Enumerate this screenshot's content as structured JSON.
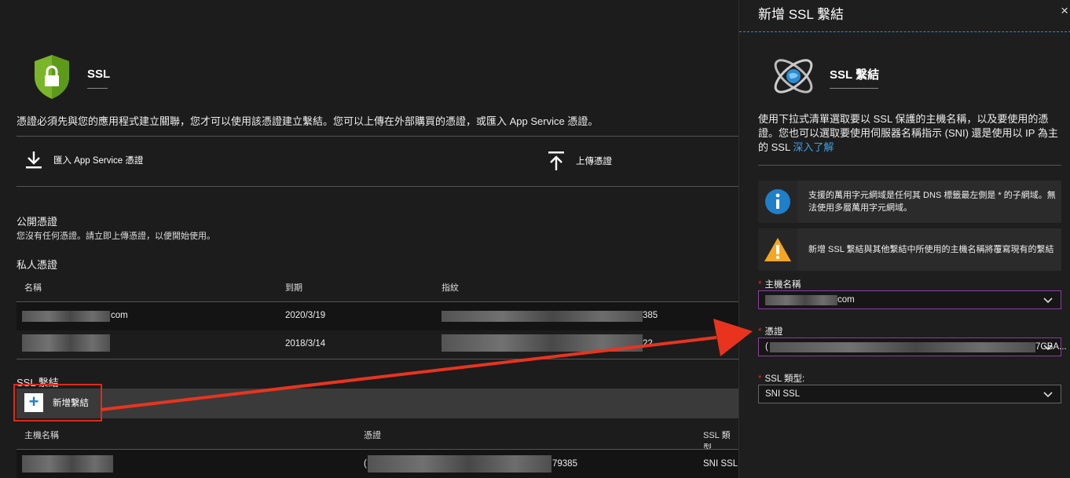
{
  "main": {
    "title": "SSL",
    "description": "憑證必須先與您的應用程式建立關聯，您才可以使用該憑證建立繫結。您可以上傳在外部購買的憑證，或匯入 App Service 憑證。",
    "commands": {
      "import_label": "匯入 App Service 憑證",
      "upload_label": "上傳憑證"
    },
    "public_certs": {
      "title": "公開憑證",
      "empty_text": "您沒有任何憑證。請立即上傳憑證，以便開始使用。"
    },
    "private_certs": {
      "title": "私人憑證",
      "columns": [
        "名稱",
        "到期",
        "指紋"
      ],
      "rows": [
        {
          "name_suffix": "com",
          "expiry": "2020/3/19",
          "thumb_suffix": "385"
        },
        {
          "name_suffix": "",
          "expiry": "2018/3/14",
          "thumb_suffix": "22"
        }
      ]
    },
    "bindings": {
      "title": "SSL 繫結",
      "add_label": "新增繫結",
      "columns": [
        "主機名稱",
        "憑證",
        "SSL 類型"
      ],
      "rows": [
        {
          "cert_prefix": "(",
          "cert_suffix": "79385",
          "ssl_type": "SNI SSL"
        }
      ]
    }
  },
  "panel": {
    "title": "新增 SSL 繫結",
    "close_glyph": "×",
    "subtitle": "SSL 繫結",
    "description": "使用下拉式清單選取要以 SSL 保護的主機名稱，以及要使用的憑證。您也可以選取要使用伺服器名稱指示 (SNI) 還是使用以 IP 為主的 SSL ",
    "learn_more": "深入了解",
    "info_notice": "支援的萬用字元網域是任何其 DNS 標籤最左側是 * 的子網域。無法使用多層萬用字元網域。",
    "warn_notice": "新增 SSL 繫結與其他繫結中所使用的主機名稱將覆寫現有的繫結",
    "fields": {
      "hostname": {
        "required_mark": "*",
        "label": "主機名稱",
        "value_suffix": "com"
      },
      "certificate": {
        "required_mark": "*",
        "label": "憑證",
        "value_prefix": "(",
        "value_suffix": "7CBA..."
      },
      "ssl_type": {
        "required_mark": "*",
        "label": "SSL 類型:",
        "value": "SNI SSL"
      }
    }
  },
  "colors": {
    "accent_blue": "#3fa2e6",
    "highlight_red": "#e0291a",
    "shield_green": "#7bb52a",
    "field_focus_purple": "#8c3fa0"
  },
  "icons": [
    "shield-lock-icon",
    "download-icon",
    "upload-icon",
    "plus-icon",
    "ssl-globe-icon",
    "info-icon",
    "warning-icon",
    "chevron-down-icon",
    "close-icon",
    "red-arrow-annotation"
  ]
}
